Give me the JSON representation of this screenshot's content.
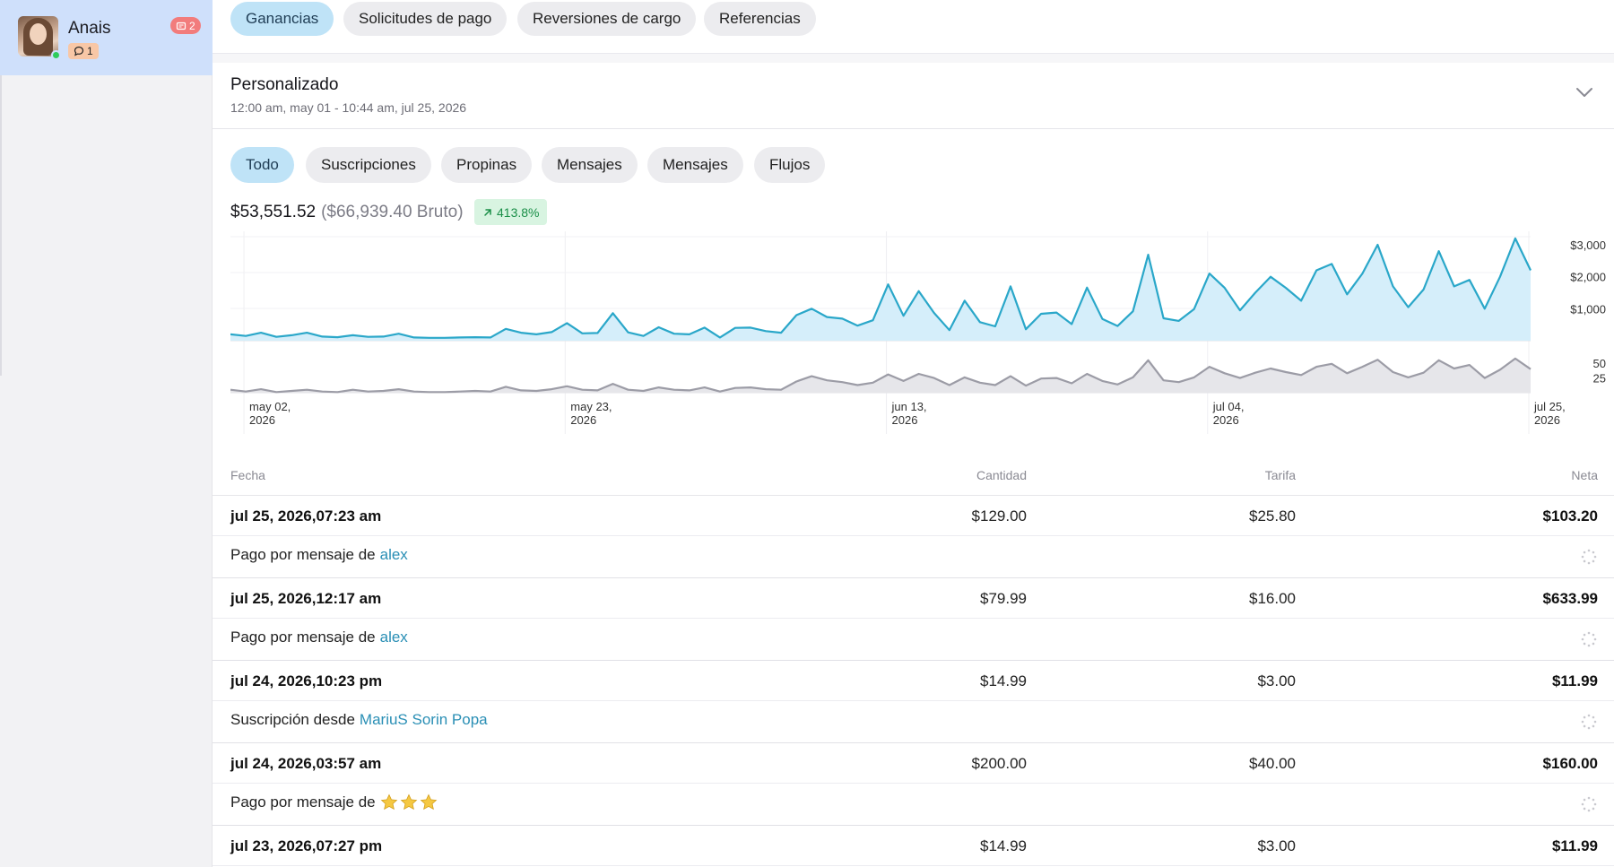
{
  "account": {
    "name": "Anais",
    "chat_count": "1",
    "message_count": "2",
    "online_color": "#2ecc5b"
  },
  "tabs": [
    {
      "label": "Ganancias",
      "active": true
    },
    {
      "label": "Solicitudes de pago",
      "active": false
    },
    {
      "label": "Reversiones de cargo",
      "active": false
    },
    {
      "label": "Referencias",
      "active": false
    }
  ],
  "period": {
    "title": "Personalizado",
    "range": "12:00 am, may 01 - 10:44 am, jul 25, 2026"
  },
  "filters": [
    {
      "label": "Todo",
      "active": true
    },
    {
      "label": "Suscripciones",
      "active": false
    },
    {
      "label": "Propinas",
      "active": false
    },
    {
      "label": "Mensajes",
      "active": false
    },
    {
      "label": "Mensajes",
      "active": false
    },
    {
      "label": "Flujos",
      "active": false
    }
  ],
  "summary": {
    "net": "$53,551.52",
    "gross": "($66,939.40 Bruto)",
    "growth": "413.8%"
  },
  "chart_data": {
    "type": "area",
    "x_tick_labels": [
      [
        "may 02,",
        "2026"
      ],
      [
        "may 23,",
        "2026"
      ],
      [
        "jun 13,",
        "2026"
      ],
      [
        "jul 04,",
        "2026"
      ],
      [
        "jul 25,",
        "2026"
      ]
    ],
    "x_ticks_day_index": [
      1,
      22,
      43,
      64,
      85
    ],
    "series": [
      {
        "values": [
          200,
          150,
          250,
          120,
          170,
          250,
          130,
          110,
          170,
          120,
          130,
          220,
          100,
          90,
          90,
          100,
          110,
          100,
          370,
          250,
          200,
          270,
          550,
          230,
          240,
          860,
          260,
          150,
          420,
          220,
          200,
          410,
          100,
          400,
          410,
          300,
          250,
          800,
          1000,
          740,
          690,
          470,
          640,
          1760,
          780,
          1550,
          870,
          330,
          1250,
          580,
          450,
          1700,
          360,
          840,
          880,
          520,
          1660,
          680,
          460,
          920,
          2690,
          700,
          620,
          990,
          2100,
          1650,
          950,
          1500,
          2000,
          1650,
          1250,
          2200,
          2400,
          1450,
          2100,
          3000,
          1700,
          1050,
          1600,
          2800,
          1700,
          1900,
          1000,
          2000,
          3200,
          2200
        ],
        "y_axis_ticks": [
          "$3,000",
          "$2,000",
          "$1,000"
        ],
        "y_range": [
          0,
          3000
        ],
        "color": "#2aa7c9",
        "fill": "#d5eefa"
      },
      {
        "values": [
          5,
          2,
          6,
          1,
          3,
          5,
          2,
          1,
          5,
          2,
          3,
          6,
          2,
          1,
          1,
          2,
          3,
          2,
          10,
          4,
          3,
          6,
          11,
          5,
          4,
          15,
          5,
          3,
          9,
          5,
          4,
          9,
          2,
          8,
          9,
          6,
          5,
          19,
          28,
          21,
          18,
          13,
          17,
          31,
          20,
          32,
          25,
          13,
          26,
          17,
          13,
          28,
          12,
          24,
          25,
          16,
          32,
          20,
          14,
          26,
          55,
          21,
          18,
          26,
          44,
          33,
          25,
          34,
          41,
          35,
          30,
          44,
          49,
          33,
          44,
          56,
          35,
          26,
          34,
          55,
          41,
          47,
          25,
          39,
          58,
          40
        ],
        "y_axis_ticks": [
          "50",
          "25"
        ],
        "y_range": [
          0,
          75
        ],
        "color": "#9c9ca6",
        "fill": "#e6e6ea"
      }
    ]
  },
  "table": {
    "headers": {
      "date": "Fecha",
      "amount": "Cantidad",
      "fee": "Tarifa",
      "net": "Neta"
    },
    "rows": [
      {
        "date": "jul 25, 2026,07:23 am",
        "amount": "$129.00",
        "fee": "$25.80",
        "net": "$103.20",
        "desc": "Pago por mensaje de",
        "who": "alex",
        "stars": false
      },
      {
        "date": "jul 25, 2026,12:17 am",
        "amount": "$79.99",
        "fee": "$16.00",
        "net": "$633.99",
        "desc": "Pago por mensaje de",
        "who": "alex",
        "stars": false
      },
      {
        "date": "jul 24, 2026,10:23 pm",
        "amount": "$14.99",
        "fee": "$3.00",
        "net": "$11.99",
        "desc": "Suscripción desde",
        "who": "MariuS Sorin Popa",
        "stars": false
      },
      {
        "date": "jul 24, 2026,03:57 am",
        "amount": "$200.00",
        "fee": "$40.00",
        "net": "$160.00",
        "desc": "Pago por mensaje de",
        "who": "",
        "stars": true
      },
      {
        "date": "jul 23, 2026,07:27 pm",
        "amount": "$14.99",
        "fee": "$3.00",
        "net": "$11.99",
        "desc": "",
        "who": "",
        "stars": false
      }
    ]
  }
}
